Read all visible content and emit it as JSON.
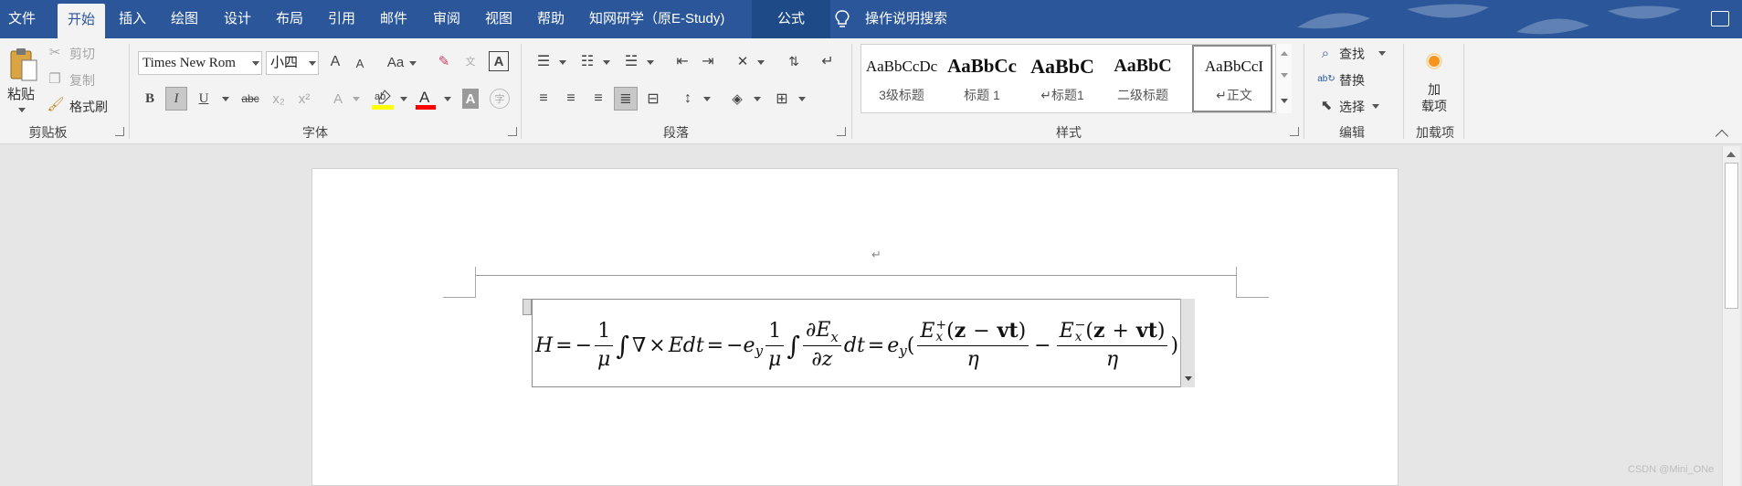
{
  "tabs": {
    "file": "文件",
    "home": "开始",
    "insert": "插入",
    "draw": "绘图",
    "design": "设计",
    "layout": "布局",
    "references": "引用",
    "mailings": "邮件",
    "review": "审阅",
    "view": "视图",
    "help": "帮助",
    "cnki": "知网研学（原E-Study)",
    "equation": "公式",
    "tell_me": "操作说明搜索"
  },
  "clipboard": {
    "paste": "粘贴",
    "cut": "剪切",
    "copy": "复制",
    "format_painter": "格式刷",
    "group_label": "剪贴板"
  },
  "font": {
    "font_name": "Times New Rom",
    "font_size": "小四",
    "group_label": "字体",
    "grow": "A",
    "shrink": "A",
    "change_case": "Aa",
    "bold": "B",
    "italic": "I",
    "underline": "U",
    "strikethrough": "abc",
    "subscript": "x₂",
    "superscript": "x²"
  },
  "paragraph": {
    "group_label": "段落"
  },
  "styles": {
    "group_label": "样式",
    "items": [
      {
        "sample": "AaBbCcDc",
        "name": "3级标题"
      },
      {
        "sample": "AaBbCc",
        "name": "标题 1"
      },
      {
        "sample": "AaBbC",
        "name": "↵标题1"
      },
      {
        "sample": "AaBbC",
        "name": "二级标题"
      },
      {
        "sample": "AaBbCcI",
        "name": "↵正文"
      }
    ]
  },
  "editing": {
    "find": "查找",
    "replace": "替换",
    "select": "选择",
    "group_label": "编辑"
  },
  "addins": {
    "button": "加\n载项",
    "group_label": "加载项"
  },
  "document": {
    "paragraph_mark": "↵",
    "equation_text": "H = −1/μ ∫ ∇ × E dt = −e_y 1/μ ∫ ∂E_x/∂z dt = e_y((E_x^+(z − vt))/η − (E_x^−(z + vt))/η)"
  },
  "watermark": "CSDN @Mini_ONe",
  "colors": {
    "tab_bar": "#2b579a",
    "ribbon": "#f3f3f3",
    "highlight_yellow": "#ffff00",
    "font_color_red": "#ff0000"
  }
}
